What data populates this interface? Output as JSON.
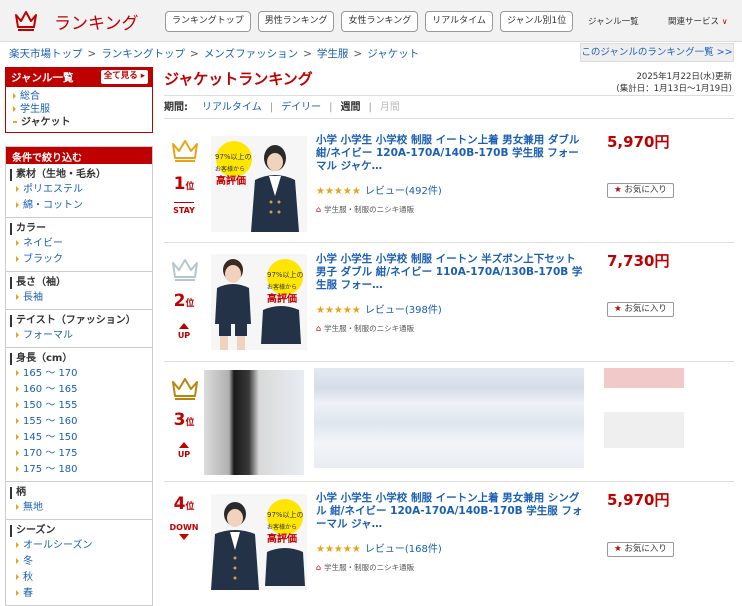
{
  "header": {
    "logo_text": "ランキング",
    "nav": [
      "ランキングトップ",
      "男性ランキング",
      "女性ランキング",
      "リアルタイム",
      "ジャンル別1位"
    ],
    "genre_list": "ジャンル一覧",
    "related": "関連サービス"
  },
  "breadcrumb": [
    "楽天市場トップ",
    "ランキングトップ",
    "メンズファッション",
    "学生服",
    "ジャケット"
  ],
  "genre_ranking_link": "このジャンルのランキング一覧 >>",
  "sidebar": {
    "genre_title": "ジャンル一覧",
    "see_all": "全て見る",
    "genres": [
      "総合",
      "学生服",
      "ジャケット"
    ],
    "filter_title": "条件で絞り込む",
    "filters": [
      {
        "title": "素材（生地・毛糸）",
        "items": [
          "ポリエステル",
          "綿・コットン"
        ]
      },
      {
        "title": "カラー",
        "items": [
          "ネイビー",
          "ブラック"
        ]
      },
      {
        "title": "長さ（袖）",
        "items": [
          "長袖"
        ]
      },
      {
        "title": "テイスト（ファッション）",
        "items": [
          "フォーマル"
        ]
      },
      {
        "title": "身長（cm）",
        "items": [
          "165 ～ 170",
          "160 ～ 165",
          "150 ～ 155",
          "155 ～ 160",
          "145 ～ 150",
          "170 ～ 175",
          "175 ～ 180"
        ]
      },
      {
        "title": "柄",
        "items": [
          "無地"
        ]
      },
      {
        "title": "シーズン",
        "items": [
          "オールシーズン",
          "冬",
          "秋",
          "春"
        ]
      }
    ]
  },
  "main": {
    "title": "ジャケットランキング",
    "updated_line1": "2025年1月22日(水)更新",
    "updated_line2": "(集計日：1月13日～1月19日)",
    "period_label": "期間:",
    "periods": [
      "リアルタイム",
      "デイリー",
      "週間",
      "月間"
    ]
  },
  "badge": {
    "line1": "97%以上の",
    "line2": "お客様から",
    "line3": "高評価"
  },
  "products": [
    {
      "rank": "1",
      "rank_suffix": "位",
      "status": "STAY",
      "title": "小学 小学生 小学校 制服 イートン上着 男女兼用 ダブル 紺/ネイビー 120A-170A/140B-170B 学生服 フォーマル ジャケ…",
      "price": "5,970円",
      "stars": "★★★★★",
      "review": "レビュー(492件)",
      "shop": "学生服・制服のニシキ通販",
      "fav": "お気に入り"
    },
    {
      "rank": "2",
      "rank_suffix": "位",
      "status": "UP",
      "title": "小学 小学生 小学校 制服 イートン 半ズボン上下セット 男子 ダブル 紺/ネイビー 110A-170A/130B-170B 学生服 フォー…",
      "price": "7,730円",
      "stars": "★★★★★",
      "review": "レビュー(398件)",
      "shop": "学生服・制服のニシキ通販",
      "fav": "お気に入り"
    },
    {
      "rank": "3",
      "rank_suffix": "位",
      "status": "UP"
    },
    {
      "rank": "4",
      "rank_suffix": "位",
      "status": "DOWN",
      "title": "小学 小学生 小学校 制服 イートン上着 男女兼用 シングル 紺/ネイビー 120A-170A/140B-170B 学生服 フォーマル ジャ…",
      "price": "5,970円",
      "stars": "★★★★★",
      "review": "レビュー(168件)",
      "shop": "学生服・制服のニシキ通販",
      "fav": "お気に入り"
    }
  ],
  "colors": {
    "brand": "#bf0000",
    "link": "#1a5fb4",
    "star": "#e8a317",
    "gold": "#e8a317",
    "silver": "#b8c4cf",
    "bronze": "#b8860b"
  }
}
